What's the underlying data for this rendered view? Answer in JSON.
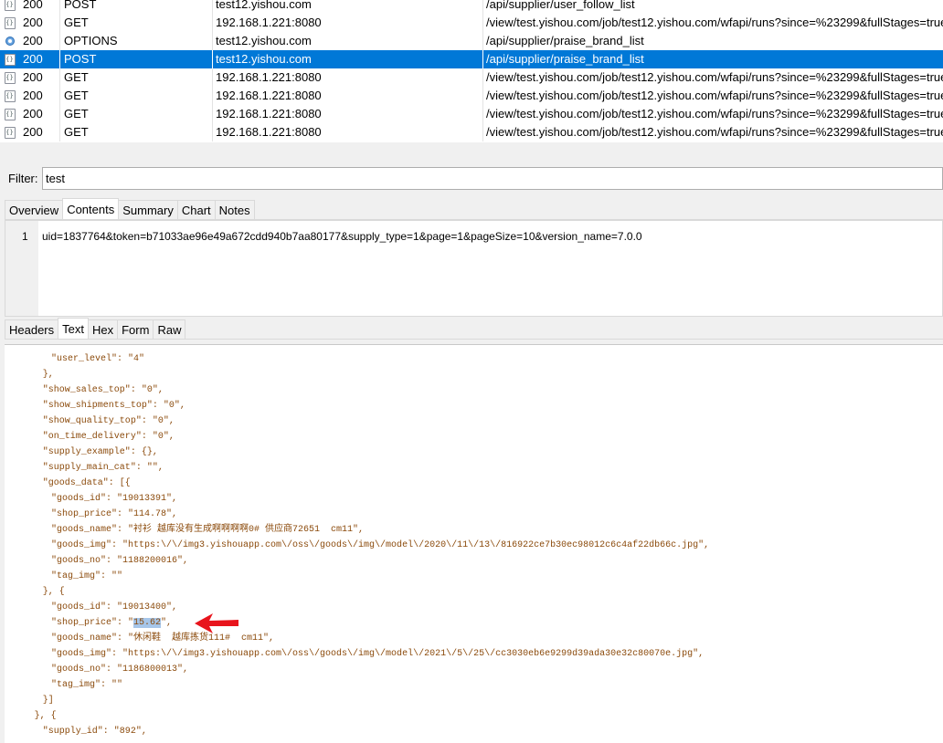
{
  "requests": [
    {
      "icon": "json",
      "status": "200",
      "method": "POST",
      "host": "test12.yishou.com",
      "url": "/api/supplier/user_follow_list",
      "selected": false
    },
    {
      "icon": "json",
      "status": "200",
      "method": "GET",
      "host": "192.168.1.221:8080",
      "url": "/view/test.yishou.com/job/test12.yishou.com/wfapi/runs?since=%23299&fullStages=true",
      "selected": false
    },
    {
      "icon": "options",
      "status": "200",
      "method": "OPTIONS",
      "host": "test12.yishou.com",
      "url": "/api/supplier/praise_brand_list",
      "selected": false
    },
    {
      "icon": "json",
      "status": "200",
      "method": "POST",
      "host": "test12.yishou.com",
      "url": "/api/supplier/praise_brand_list",
      "selected": true
    },
    {
      "icon": "json",
      "status": "200",
      "method": "GET",
      "host": "192.168.1.221:8080",
      "url": "/view/test.yishou.com/job/test12.yishou.com/wfapi/runs?since=%23299&fullStages=true",
      "selected": false
    },
    {
      "icon": "json",
      "status": "200",
      "method": "GET",
      "host": "192.168.1.221:8080",
      "url": "/view/test.yishou.com/job/test12.yishou.com/wfapi/runs?since=%23299&fullStages=true",
      "selected": false
    },
    {
      "icon": "json",
      "status": "200",
      "method": "GET",
      "host": "192.168.1.221:8080",
      "url": "/view/test.yishou.com/job/test12.yishou.com/wfapi/runs?since=%23299&fullStages=true",
      "selected": false
    },
    {
      "icon": "json",
      "status": "200",
      "method": "GET",
      "host": "192.168.1.221:8080",
      "url": "/view/test.yishou.com/job/test12.yishou.com/wfapi/runs?since=%23299&fullStages=true",
      "selected": false
    }
  ],
  "filter": {
    "label": "Filter:",
    "value": "test"
  },
  "top_tabs": [
    {
      "label": "Overview",
      "active": false
    },
    {
      "label": "Contents",
      "active": true
    },
    {
      "label": "Summary",
      "active": false
    },
    {
      "label": "Chart",
      "active": false
    },
    {
      "label": "Notes",
      "active": false
    }
  ],
  "request_body": {
    "line_number": "1",
    "text": "uid=1837764&token=b71033ae96e49a672cdd940b7aa80177&supply_type=1&page=1&pageSize=10&version_name=7.0.0"
  },
  "bottom_tabs": [
    {
      "label": "Headers",
      "active": false
    },
    {
      "label": "Text",
      "active": true
    },
    {
      "label": "Hex",
      "active": false
    },
    {
      "label": "Form",
      "active": false
    },
    {
      "label": "Raw",
      "active": false
    }
  ],
  "json_lines": [
    {
      "indent": 5,
      "text": "\"user_level\": \"4\""
    },
    {
      "indent": 4,
      "text": "},"
    },
    {
      "indent": 4,
      "text": "\"show_sales_top\": \"0\","
    },
    {
      "indent": 4,
      "text": "\"show_shipments_top\": \"0\","
    },
    {
      "indent": 4,
      "text": "\"show_quality_top\": \"0\","
    },
    {
      "indent": 4,
      "text": "\"on_time_delivery\": \"0\","
    },
    {
      "indent": 4,
      "text": "\"supply_example\": {},"
    },
    {
      "indent": 4,
      "text": "\"supply_main_cat\": \"\","
    },
    {
      "indent": 4,
      "text": "\"goods_data\": [{"
    },
    {
      "indent": 5,
      "text": "\"goods_id\": \"19013391\","
    },
    {
      "indent": 5,
      "text": "\"shop_price\": \"114.78\","
    },
    {
      "indent": 5,
      "text": "\"goods_name\": \"衬衫 越库没有生成啊啊啊啊0# 供应商72651  cm11\","
    },
    {
      "indent": 5,
      "text": "\"goods_img\": \"https:\\/\\/img3.yishouapp.com\\/oss\\/goods\\/img\\/model\\/2020\\/11\\/13\\/816922ce7b30ec98012c6c4af22db66c.jpg\","
    },
    {
      "indent": 5,
      "text": "\"goods_no\": \"1188200016\","
    },
    {
      "indent": 5,
      "text": "\"tag_img\": \"\""
    },
    {
      "indent": 4,
      "text": "}, {"
    },
    {
      "indent": 5,
      "text": "\"goods_id\": \"19013400\","
    },
    {
      "indent": 5,
      "pre": "\"shop_price\": \"",
      "hl": "15.62",
      "post": "\","
    },
    {
      "indent": 5,
      "text": "\"goods_name\": \"休闲鞋  越库拣货111#  cm11\","
    },
    {
      "indent": 5,
      "text": "\"goods_img\": \"https:\\/\\/img3.yishouapp.com\\/oss\\/goods\\/img\\/model\\/2021\\/5\\/25\\/cc3030eb6e9299d39ada30e32c80070e.jpg\","
    },
    {
      "indent": 5,
      "text": "\"goods_no\": \"1186800013\","
    },
    {
      "indent": 5,
      "text": "\"tag_img\": \"\""
    },
    {
      "indent": 4,
      "text": "}]"
    },
    {
      "indent": 3,
      "text": "}, {"
    },
    {
      "indent": 4,
      "text": "\"supply_id\": \"892\","
    }
  ],
  "colors": {
    "selection": "#0078d7",
    "json_text": "#8b4a0b",
    "highlight": "#a6c6ea",
    "arrow": "#e8141c"
  }
}
